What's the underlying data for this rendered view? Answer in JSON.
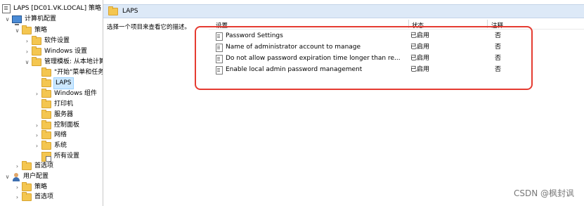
{
  "tree": {
    "root": "LAPS [DC01.VK.LOCAL] 策略",
    "computer_config": "计算机配置",
    "policies": "策略",
    "software_settings": "软件设置",
    "windows_settings": "Windows 设置",
    "admin_templates": "管理模板: 从本地计算",
    "start_menu": "\"开始\"菜单和任务",
    "laps": "LAPS",
    "windows_components": "Windows 组件",
    "printers": "打印机",
    "server": "服务器",
    "control_panel": "控制面板",
    "network": "网络",
    "system": "系统",
    "all_settings": "所有设置",
    "preferences_1": "首选项",
    "user_config": "用户配置",
    "user_policies": "策略",
    "preferences_2": "首选项"
  },
  "header": {
    "title": "LAPS"
  },
  "description": "选择一个项目来查看它的描述。",
  "columns": {
    "setting": "设置",
    "state": "状态",
    "note": "注释"
  },
  "rows": [
    {
      "name": "Password Settings",
      "state": "已启用",
      "note": "否"
    },
    {
      "name": "Name of administrator account to manage",
      "state": "已启用",
      "note": "否"
    },
    {
      "name": "Do not allow password expiration time longer than re...",
      "state": "已启用",
      "note": "否"
    },
    {
      "name": "Enable local admin password management",
      "state": "已启用",
      "note": "否"
    }
  ],
  "watermark": "CSDN @枫封讽",
  "colors": {
    "highlight": "#e53b31",
    "selected": "#cce8ff",
    "header_bg": "#dde9f7"
  }
}
